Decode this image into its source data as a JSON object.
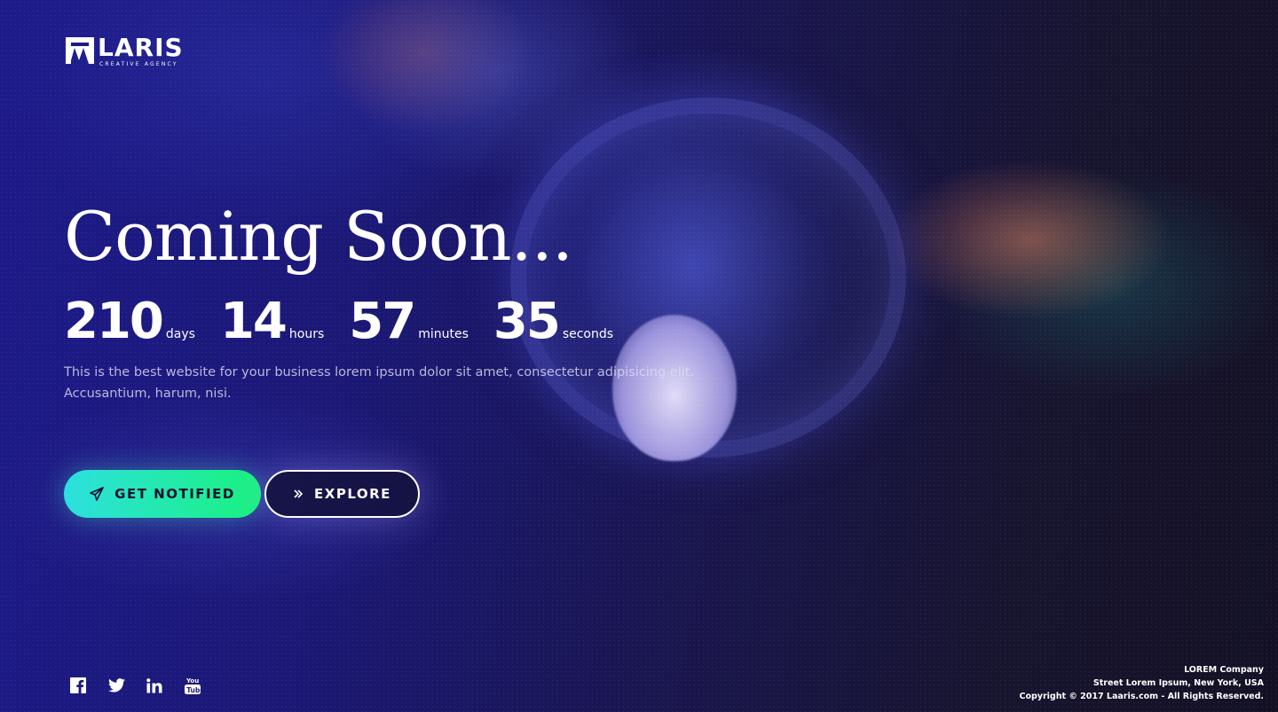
{
  "brand": {
    "name": "LARIS",
    "tagline": "CREATIVE AGENCY"
  },
  "hero": {
    "headline": "Coming Soon...",
    "description": "This is the best website for your business lorem ipsum dolor sit amet, consectetur adipisicing elit. Accusantium, harum, nisi."
  },
  "countdown": {
    "days": {
      "value": "210",
      "label": "days"
    },
    "hours": {
      "value": "14",
      "label": "hours"
    },
    "minutes": {
      "value": "57",
      "label": "minutes"
    },
    "seconds": {
      "value": "35",
      "label": "seconds"
    }
  },
  "buttons": {
    "notify": {
      "label": "GET NOTIFIED",
      "icon": "paper-plane-icon"
    },
    "explore": {
      "label": "EXPLORE",
      "icon": "double-chevron-right-icon"
    }
  },
  "social": [
    "facebook-icon",
    "twitter-icon",
    "linkedin-icon",
    "youtube-icon"
  ],
  "footer": {
    "company": "LOREM Company",
    "address": "Street Lorem Ipsum, New York, USA",
    "copyright": "Copyright © 2017 Laaris.com - All Rights Reserved."
  },
  "colors": {
    "notify_gradient_start": "#2de0e0",
    "notify_gradient_end": "#19f27d",
    "background_primary": "#1d1a8a",
    "background_dark": "#141125",
    "text": "#ffffff"
  }
}
